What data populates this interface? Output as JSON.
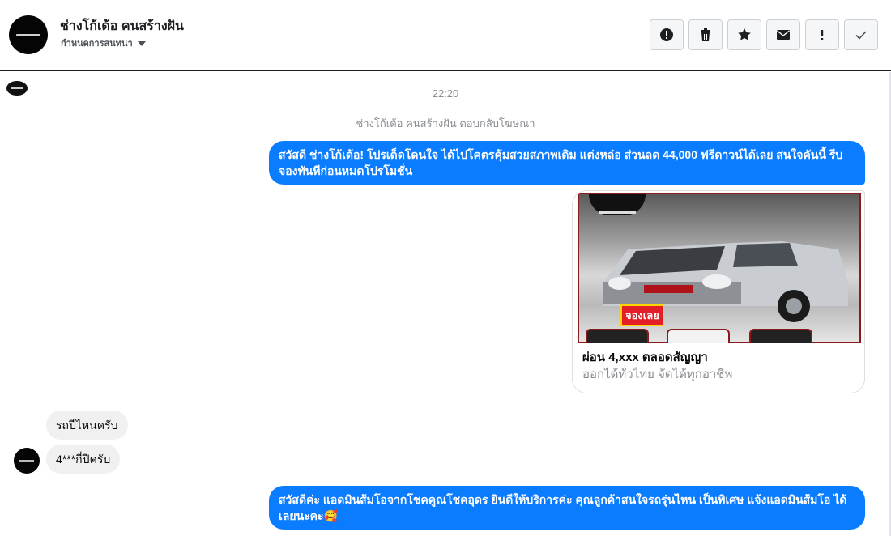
{
  "header": {
    "page_name": "ช่างโก้เด้อ คนสร้างฝัน",
    "sub_label": "กำหนดการสนทนา",
    "toolbar": [
      {
        "name": "report-button",
        "icon": "alert-circle-icon"
      },
      {
        "name": "delete-button",
        "icon": "trash-icon"
      },
      {
        "name": "star-button",
        "icon": "star-icon"
      },
      {
        "name": "mark-unread-button",
        "icon": "envelope-icon"
      },
      {
        "name": "important-button",
        "icon": "exclamation-icon"
      },
      {
        "name": "done-button",
        "icon": "check-icon"
      }
    ]
  },
  "thread": {
    "timestamp": "22:20",
    "ad_reply_note": "ช่างโก้เด้อ คนสร้างฝัน ตอบกลับโฆษณา",
    "messages": [
      {
        "text": "สวัสดี ช่างโก้เด้อ! โปรเด็ดโดนใจ ได้ไปโคตรคุ้มสวยสภาพเดิม แต่งหล่อ  ส่วนลด 44,000 ฟรีดาวน์ได้เลย  สนใจคันนี้ รีบจองทันทีก่อนหมดโปรโมชั่น"
      },
      {
        "text": "รถปีไหนครับ"
      },
      {
        "text": "4***กี่ปีครับ"
      },
      {
        "text": "สวัสดีค่ะ แอดมินส้มโอจากโชคคูณโชคอุดร ยินดีให้บริการค่ะ   คุณลูกค้าสนใจรถรุ่นไหน เป็นพิเศษ แจ้งแอดมินส้มโอ ได้เลยนะคะ🥰"
      }
    ],
    "card": {
      "tag": "จองเลย",
      "title": "ผ่อน 4,xxx ตลอดสัญญา",
      "subtitle": "ออกได้ทั่วไทย จัดได้ทุกอาชีพ"
    }
  },
  "colors": {
    "outgoing_bubble": "#0a7cff",
    "incoming_bubble": "#f0f0f0",
    "muted_text": "#8a8d91"
  }
}
